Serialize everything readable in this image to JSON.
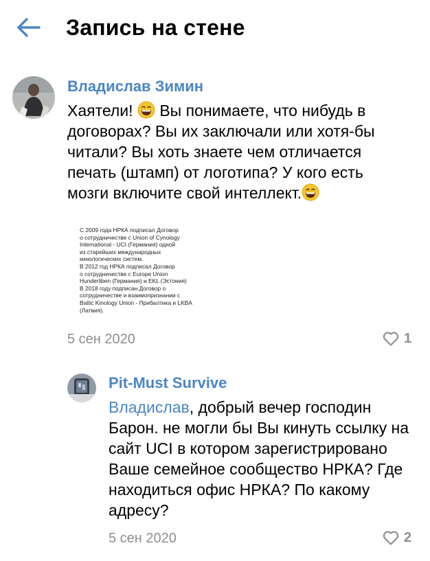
{
  "header": {
    "title": "Запись на стене",
    "back_icon": "arrow-left-icon"
  },
  "colors": {
    "accent": "#4a86c5",
    "muted": "#8e8e93"
  },
  "comments": [
    {
      "author": "Владислав Зимин",
      "text": "Хаятели! 😄 Вы понимаете, что нибудь в договорах? Вы их заключали или хотя-бы читали? Вы хоть знаете чем отличается печать (штамп) от логотипа? У кого есть мозги включите свой интеллект.😄",
      "text_parts": [
        "Хаятели! ",
        " Вы понимаете, что нибудь в договорах? Вы их заключали или хотя-бы читали? Вы хоть знаете чем отличается печать (штамп) от логотипа? У кого есть мозги включите свой интеллект."
      ],
      "attachment_text": "С 2009 года НРКА подписал Договор\nо сотрудничестве с Union of Cynology\nInternational - UCI (Германия) одной\nиз старейших международных\nкинологических систем.\nВ 2012 год НРКА подписал Договор\nо сотрудничестве с Europe Union\nHunderliben (Германия) и EKL (Эстония)\nВ 2018 году подписан Договор о\nсотрудничестве и взаимопризнании с\nBaltic Kinology Union - Прибалтика и LKBA\n(Латвия).",
      "date": "5 сен 2020",
      "likes": "1"
    },
    {
      "author": "Pit-Must Survive",
      "reply_to": "Владислав",
      "text_after": ", добрый вечер господин Барон. не могли бы Вы кинуть ссылку на сайт UCI в котором зарегистрировано Ваше семейное сообщество НРКА? Где находиться офис НРКА? По какому адресу?",
      "date": "5 сен 2020",
      "likes": "2"
    }
  ]
}
